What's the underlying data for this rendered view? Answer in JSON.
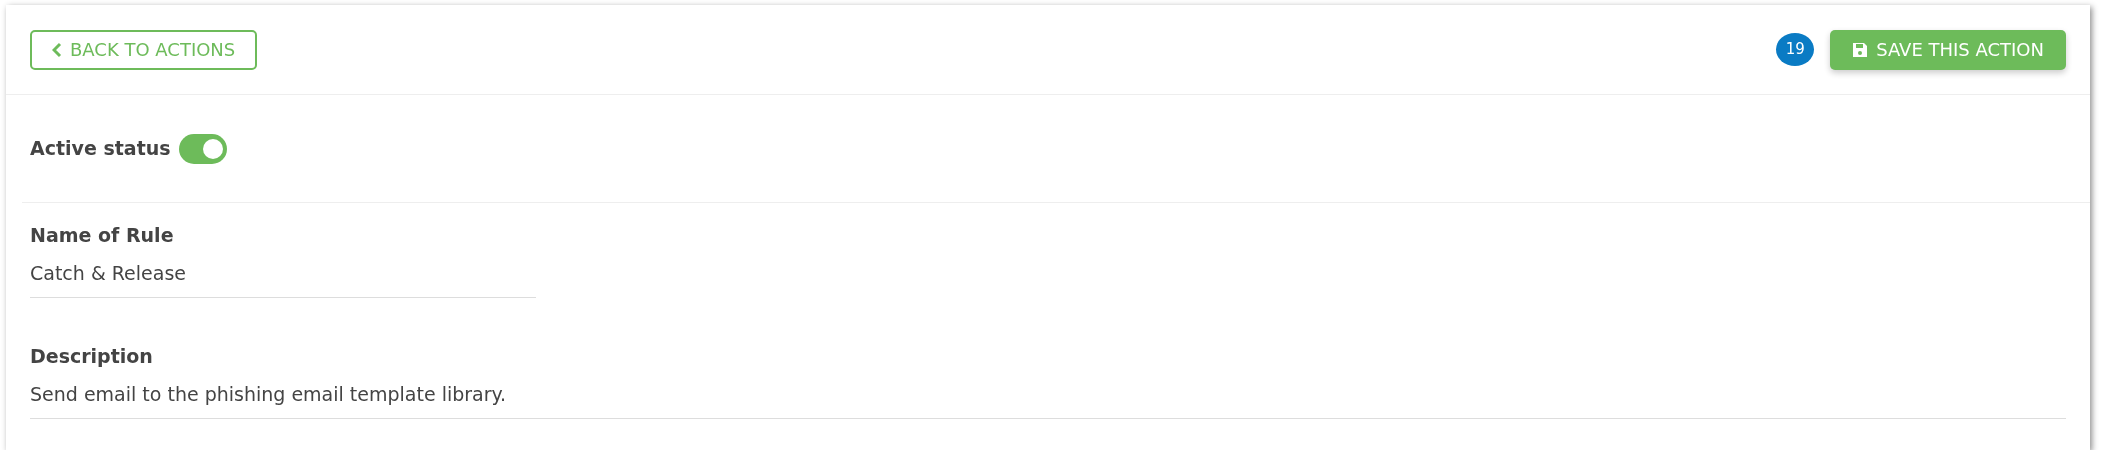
{
  "header": {
    "back_button": {
      "label": "BACK TO ACTIONS"
    },
    "badge": "19",
    "save_button": {
      "label": "SAVE THIS ACTION"
    }
  },
  "active_status": {
    "label": "Active status",
    "on": true
  },
  "fields": [
    {
      "label": "Name of Rule",
      "value": "Catch & Release",
      "wide": false
    },
    {
      "label": "Description",
      "value": "Send email to the phishing email template library.",
      "wide": true
    }
  ]
}
